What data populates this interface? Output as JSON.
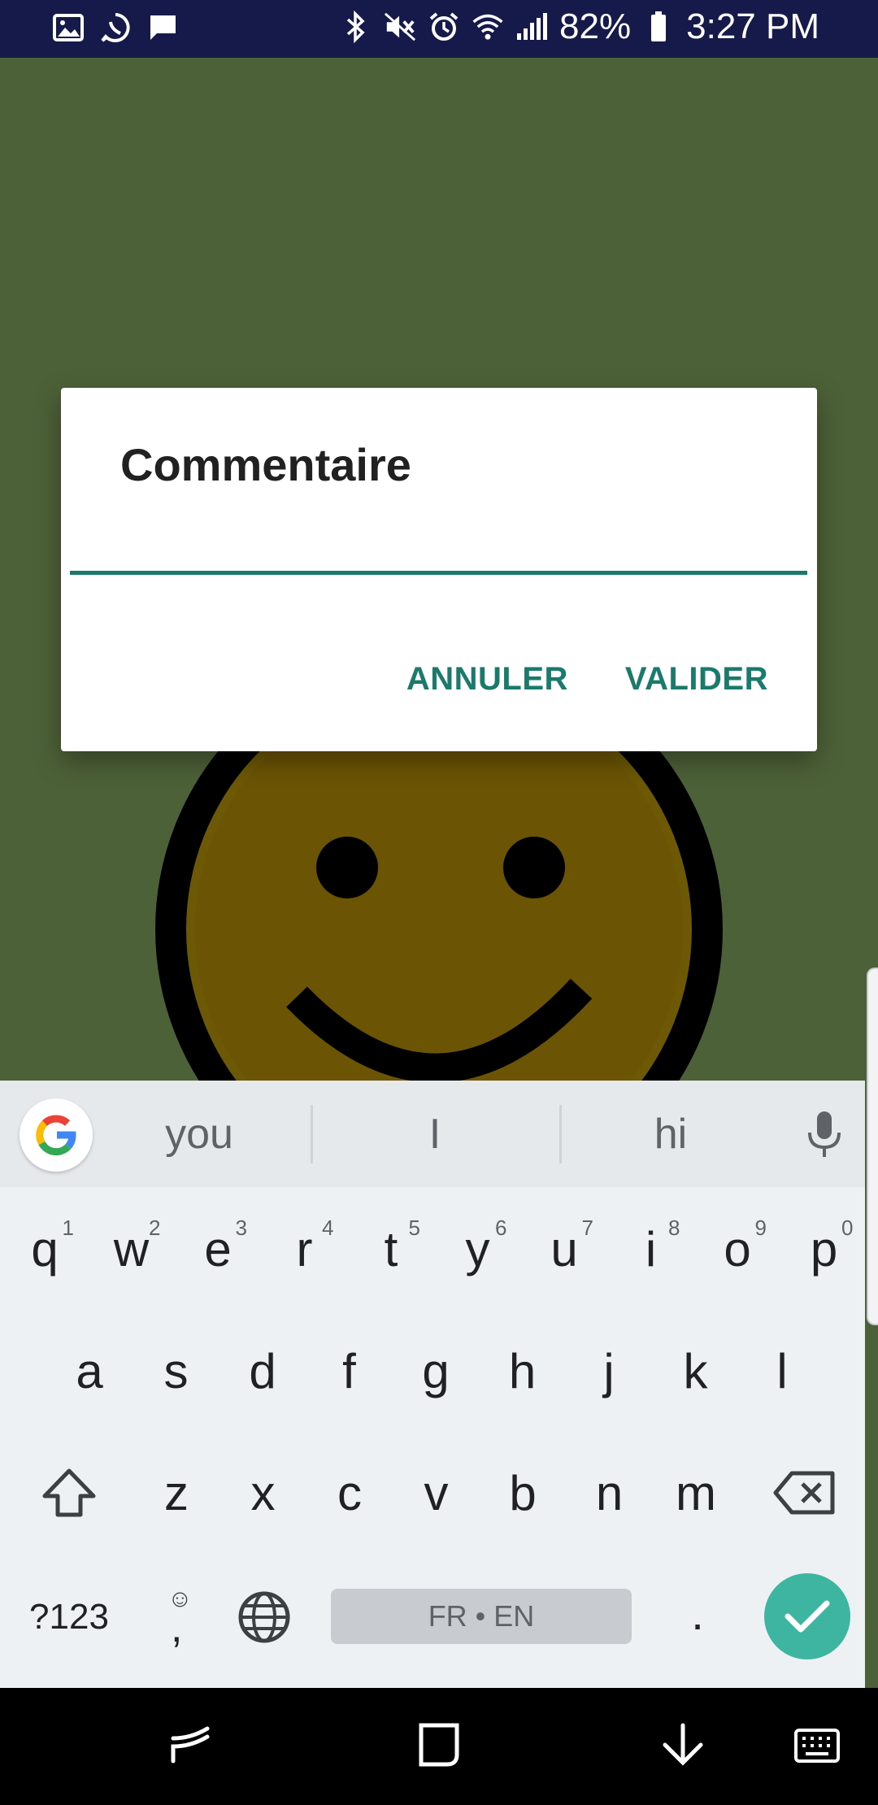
{
  "status_bar": {
    "left_icons": [
      "gallery-icon",
      "whatsapp-icon",
      "message-icon"
    ],
    "right_icons": [
      "bluetooth-icon",
      "mute-icon",
      "alarm-icon",
      "wifi-icon",
      "signal-icon"
    ],
    "battery": "82%",
    "time": "3:27 PM"
  },
  "dialog": {
    "title": "Commentaire",
    "input_value": "",
    "cancel_label": "ANNULER",
    "confirm_label": "VALIDER"
  },
  "keyboard": {
    "suggestions": [
      "you",
      "I",
      "hi"
    ],
    "row1": [
      {
        "k": "q",
        "h": "1"
      },
      {
        "k": "w",
        "h": "2"
      },
      {
        "k": "e",
        "h": "3"
      },
      {
        "k": "r",
        "h": "4"
      },
      {
        "k": "t",
        "h": "5"
      },
      {
        "k": "y",
        "h": "6"
      },
      {
        "k": "u",
        "h": "7"
      },
      {
        "k": "i",
        "h": "8"
      },
      {
        "k": "o",
        "h": "9"
      },
      {
        "k": "p",
        "h": "0"
      }
    ],
    "row2": [
      "a",
      "s",
      "d",
      "f",
      "g",
      "h",
      "j",
      "k",
      "l"
    ],
    "row3": [
      "z",
      "x",
      "c",
      "v",
      "b",
      "n",
      "m"
    ],
    "symbols_label": "?123",
    "comma_label": ",",
    "space_label": "FR • EN",
    "period_label": "."
  },
  "colors": {
    "accent": "#1a7a6b",
    "status_bar": "#161a4a",
    "app_background": "#4d6138",
    "enter_key": "#3eb5a0"
  }
}
